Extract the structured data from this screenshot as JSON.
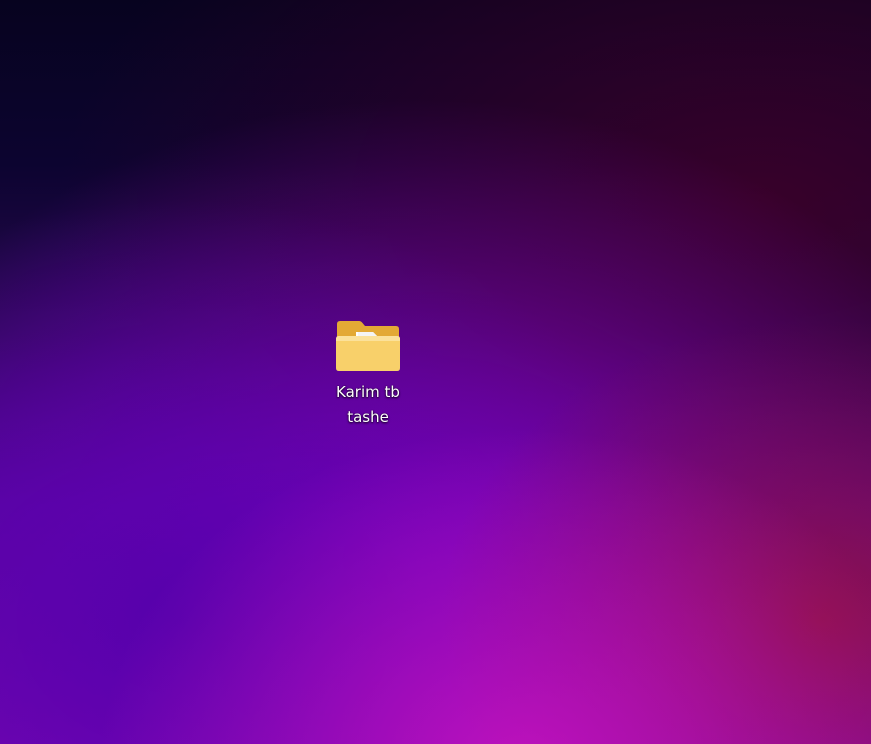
{
  "desktop": {
    "icons": [
      {
        "label_line1": "Karim tb",
        "label_line2": "tashe",
        "icon": "folder-icon"
      }
    ]
  },
  "colors": {
    "folder_front": "#f7cf62",
    "folder_back": "#e8b23e",
    "label_text": "#ffffff"
  }
}
